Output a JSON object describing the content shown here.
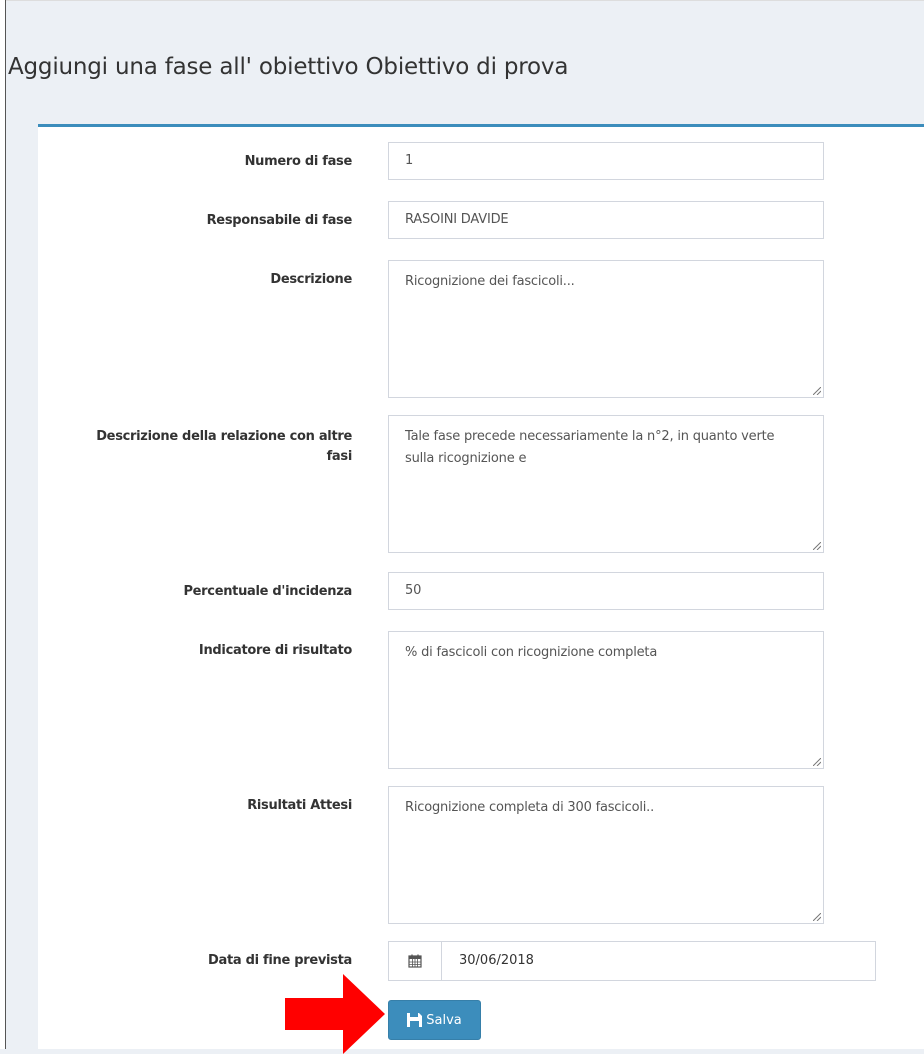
{
  "page": {
    "title": "Aggiungi una fase all' obiettivo Obiettivo di prova"
  },
  "form": {
    "numero_fase": {
      "label": "Numero di fase",
      "value": "1"
    },
    "responsabile": {
      "label": "Responsabile di fase",
      "value": "RASOINI DAVIDE"
    },
    "descrizione": {
      "label": "Descrizione",
      "value": "Ricognizione dei fascicoli..."
    },
    "relazione": {
      "label_line1": "Descrizione della relazione con altre",
      "label_line2": "fasi",
      "value": "Tale fase precede necessariamente la n°2, in quanto verte sulla ricognizione e"
    },
    "percentuale": {
      "label": "Percentuale d'incidenza",
      "value": "50"
    },
    "indicatore": {
      "label": "Indicatore di risultato",
      "value": "% di fascicoli con ricognizione completa"
    },
    "risultati": {
      "label": "Risultati Attesi",
      "value": "Ricognizione completa di 300 fascicoli.."
    },
    "data_fine": {
      "label": "Data di fine prevista",
      "value": "30/06/2018",
      "icon": "calendar-icon"
    },
    "save_label": "Salva",
    "save_icon": "floppy-disk-icon"
  },
  "annotation": {
    "icon": "red-arrow-icon",
    "color": "#ff0000"
  },
  "colors": {
    "accent": "#3c8dbc",
    "background": "#ecf0f5"
  }
}
